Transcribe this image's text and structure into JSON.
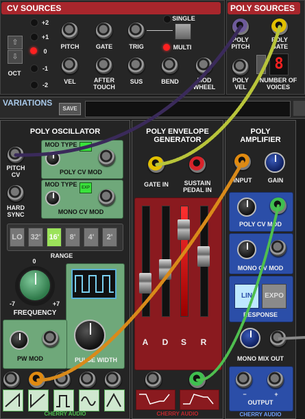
{
  "cv_sources": {
    "title": "CV SOURCES",
    "oct_label": "OCT",
    "oct_values": [
      "+2",
      "+1",
      "0",
      "-1",
      "-2"
    ],
    "oct_selected": "0",
    "jacks_row1": [
      "PITCH",
      "GATE",
      "TRIG"
    ],
    "jacks_row2": [
      "VEL",
      "AFTER TOUCH",
      "SUS",
      "BEND",
      "MOD WHEEL"
    ],
    "single_label": "SINGLE",
    "multi_label": "MULTI"
  },
  "poly_sources": {
    "title": "POLY SOURCES",
    "pitch_label": "POLY PITCH",
    "gate_label": "POLY GATE",
    "vel_label": "POLY VEL",
    "voices_label": "NUMBER OF VOICES",
    "voices_value": "8"
  },
  "variations": {
    "title": "VARIATIONS",
    "save_label": "SAVE"
  },
  "poly_oscillator": {
    "title": "POLY OSCILLATOR",
    "pitch_cv_label": "PITCH CV",
    "hard_sync_label": "HARD SYNC",
    "mod_type_label": "MOD TYPE",
    "poly_cv_mod_label": "POLY CV MOD",
    "mono_cv_mod_label": "MONO CV MOD",
    "exp_label": "EXP",
    "range_label": "RANGE",
    "range_options": [
      "LO",
      "32'",
      "16'",
      "8'",
      "4'",
      "2'"
    ],
    "range_selected": "16'",
    "frequency_label": "FREQUENCY",
    "freq_min": "-7",
    "freq_max": "+7",
    "freq_center": "0",
    "pw_mod_label": "PW MOD",
    "pulse_width_label": "PULSE WIDTH",
    "minus": "-",
    "plus": "+",
    "brand": "CHERRY AUDIO"
  },
  "poly_env": {
    "title": "POLY ENVELOPE GENERATOR",
    "gate_in_label": "GATE IN",
    "sustain_label": "SUSTAIN PEDAL IN",
    "faders": [
      "A",
      "D",
      "S",
      "R"
    ],
    "fader_levels": [
      0.25,
      0.4,
      0.85,
      0.55
    ],
    "brand": "CHERRY AUDIO"
  },
  "poly_amp": {
    "title": "POLY AMPLIFIER",
    "input_label": "INPUT",
    "gain_label": "GAIN",
    "poly_cv_mod_label": "POLY CV MOD",
    "mono_cv_mod_label": "MONO CV MOD",
    "lin_label": "LIN",
    "expo_label": "EXPO",
    "response_label": "RESPONSE",
    "mono_mix_label": "MONO MIX OUT",
    "output_label": "OUTPUT",
    "minus": "−",
    "plus": "+",
    "brand": "CHERRY AUDIO"
  },
  "colors": {
    "cable_purple": "#3a2a5a",
    "cable_yellow": "#b8c43a",
    "cable_orange": "#d98a1a",
    "cable_green": "#4fbf4f",
    "accent_red": "#c0282e",
    "osc_green": "#5a9a6a",
    "amp_blue": "#2b4ea8"
  }
}
